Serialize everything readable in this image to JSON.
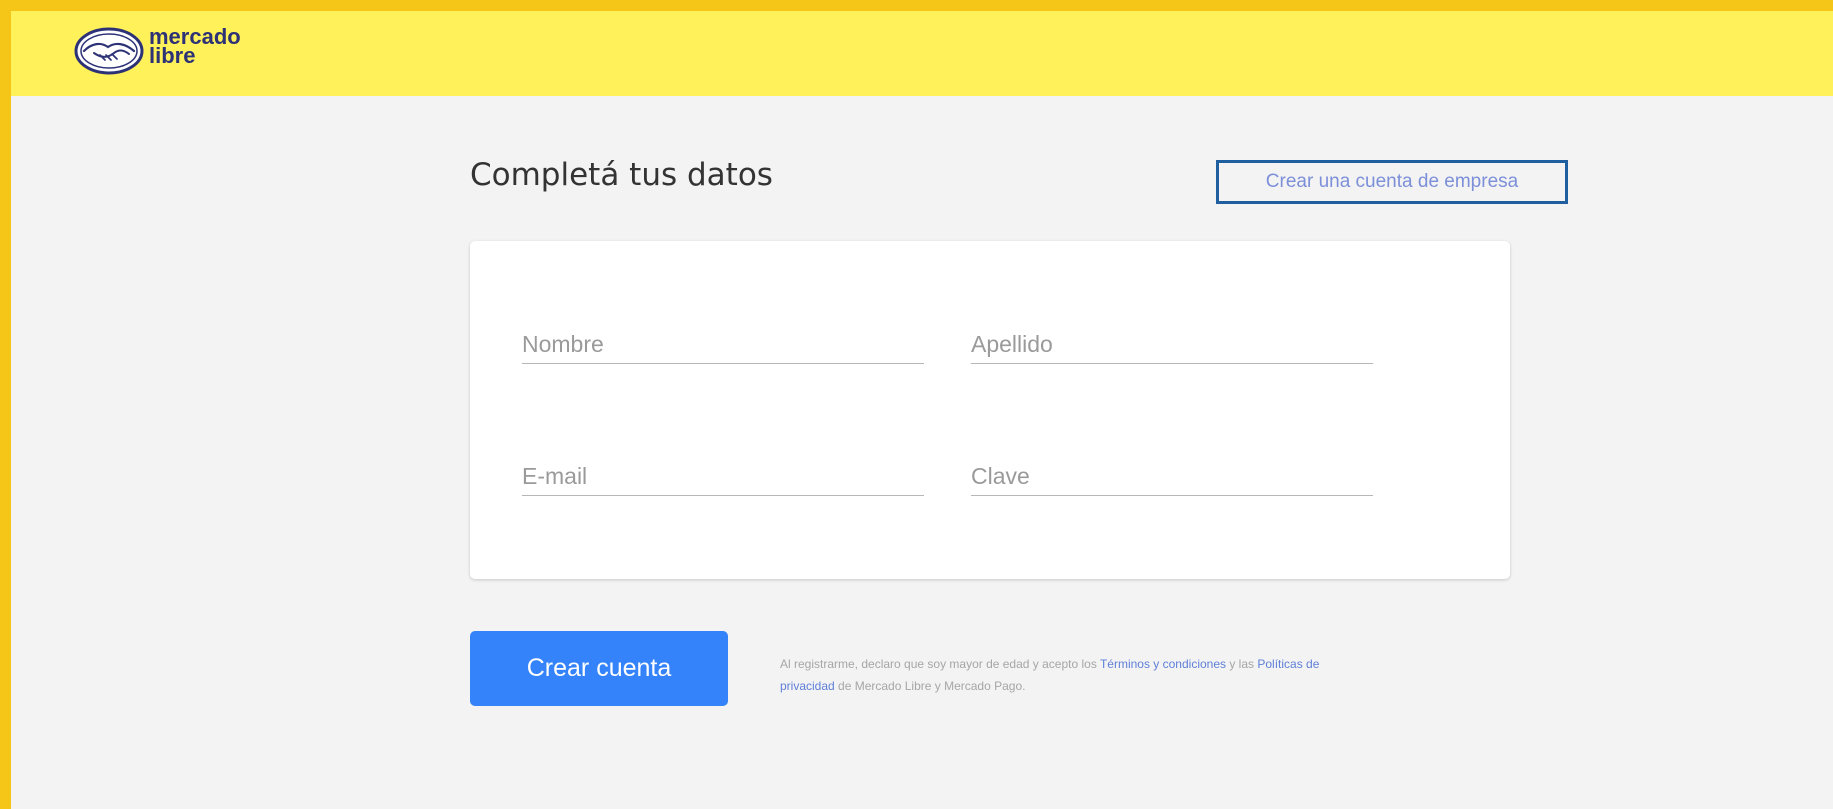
{
  "header": {
    "logo_line1": "mercado",
    "logo_line2": "libre",
    "logo_icon": "handshake-icon",
    "bg_color": "#fff159"
  },
  "page": {
    "title": "Completá tus datos",
    "business_link": "Crear una cuenta de empresa",
    "frame_color": "#f5c518",
    "background_color": "#f3f3f3"
  },
  "form": {
    "first_name": {
      "value": "",
      "placeholder": "Nombre"
    },
    "last_name": {
      "value": "",
      "placeholder": "Apellido"
    },
    "email": {
      "value": "",
      "placeholder": "E-mail"
    },
    "password": {
      "value": "",
      "placeholder": "Clave"
    }
  },
  "submit": {
    "label": "Crear cuenta",
    "color": "#3483fa"
  },
  "legal": {
    "prefix": "Al registrarme, declaro que soy mayor de edad y acepto los ",
    "terms_link": "Términos y condiciones",
    "middle": " y las ",
    "privacy_link": "Políticas de privacidad",
    "suffix": " de Mercado Libre y Mercado Pago."
  }
}
